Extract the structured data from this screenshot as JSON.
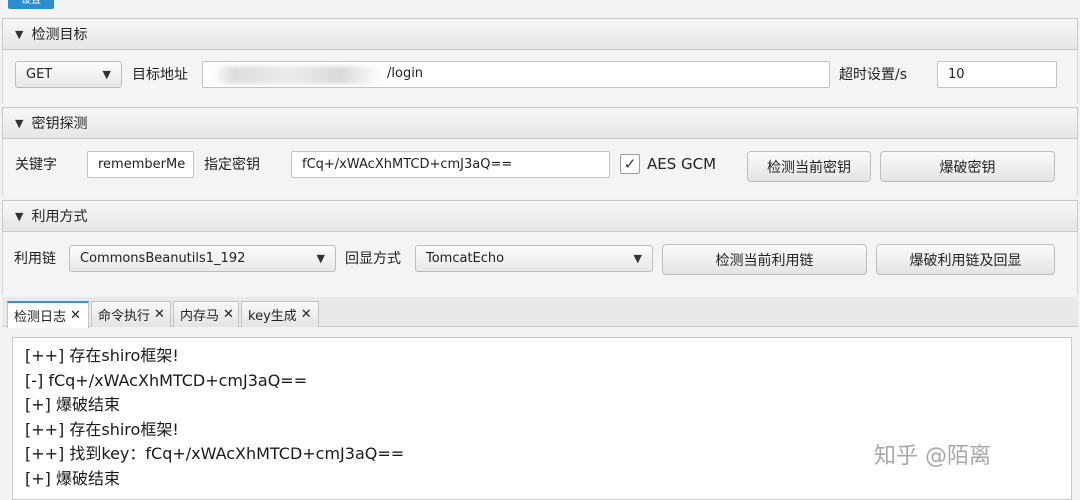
{
  "top_tab": {
    "label": "设置"
  },
  "target_section": {
    "header": "检测目标",
    "method": "GET",
    "url_label": "目标地址",
    "url_value": "/login",
    "timeout_label": "超时设置/s",
    "timeout_value": "10"
  },
  "key_section": {
    "header": "密钥探测",
    "keyword_label": "关键字",
    "keyword_value": "rememberMe",
    "key_label": "指定密钥",
    "key_value": "fCq+/xWAcXhMTCD+cmJ3aQ==",
    "aes_gcm_label": "AES GCM",
    "aes_gcm_checked": true,
    "detect_key_button": "检测当前密钥",
    "brute_key_button": "爆破密钥"
  },
  "exploit_section": {
    "header": "利用方式",
    "chain_label": "利用链",
    "chain_value": "CommonsBeanutils1_192",
    "echo_label": "回显方式",
    "echo_value": "TomcatEcho",
    "detect_chain_button": "检测当前利用链",
    "brute_chain_button": "爆破利用链及回显"
  },
  "tabs": [
    {
      "label": "检测日志",
      "close": "✕"
    },
    {
      "label": "命令执行",
      "close": "✕"
    },
    {
      "label": "内存马",
      "close": "✕"
    },
    {
      "label": "key生成",
      "close": "✕"
    }
  ],
  "log_lines": [
    "[++] 存在shiro框架!",
    "[-] fCq+/xWAcXhMTCD+cmJ3aQ==",
    "[+] 爆破结束",
    "[++] 存在shiro框架!",
    "[++] 找到key：fCq+/xWAcXhMTCD+cmJ3aQ==",
    "[+] 爆破结束"
  ],
  "watermark": "知乎 @陌离",
  "icons": {
    "collapse": "triangle-down-icon",
    "dropdown": "chevron-down-icon",
    "check": "check-icon",
    "close": "close-icon"
  },
  "colors": {
    "accent": "#3a8fd6",
    "top_tab": "#2a8fd0"
  }
}
